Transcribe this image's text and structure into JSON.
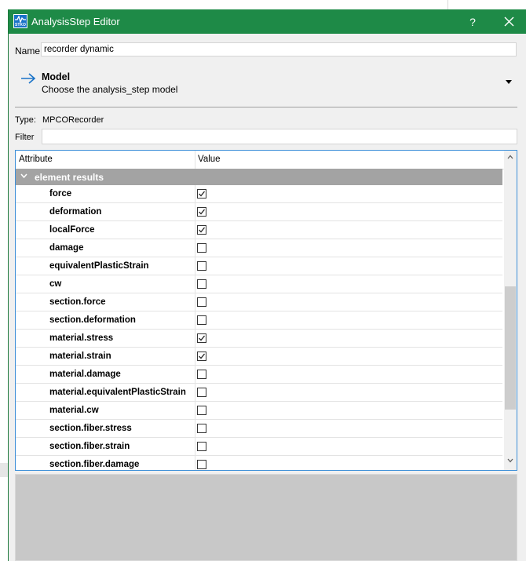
{
  "window": {
    "title": "AnalysisStep Editor",
    "help_label": "?",
    "app_icon_text": "STKO"
  },
  "name": {
    "label": "Name",
    "value": "recorder dynamic"
  },
  "model": {
    "title": "Model",
    "subtitle": "Choose the analysis_step model"
  },
  "type": {
    "label": "Type:",
    "value": "MPCORecorder"
  },
  "filter": {
    "label": "Filter",
    "value": ""
  },
  "table": {
    "headers": {
      "attribute": "Attribute",
      "value": "Value"
    },
    "group": "element results",
    "rows": [
      {
        "name": "force",
        "checked": true
      },
      {
        "name": "deformation",
        "checked": true
      },
      {
        "name": "localForce",
        "checked": true
      },
      {
        "name": "damage",
        "checked": false
      },
      {
        "name": "equivalentPlasticStrain",
        "checked": false
      },
      {
        "name": "cw",
        "checked": false
      },
      {
        "name": "section.force",
        "checked": false
      },
      {
        "name": "section.deformation",
        "checked": false
      },
      {
        "name": "material.stress",
        "checked": true
      },
      {
        "name": "material.strain",
        "checked": true
      },
      {
        "name": "material.damage",
        "checked": false
      },
      {
        "name": "material.equivalentPlasticStrain",
        "checked": false
      },
      {
        "name": "material.cw",
        "checked": false
      },
      {
        "name": "section.fiber.stress",
        "checked": false
      },
      {
        "name": "section.fiber.strain",
        "checked": false
      },
      {
        "name": "section.fiber.damage",
        "checked": false
      }
    ]
  },
  "colors": {
    "titlebar": "#1e8a47",
    "group_row": "#a3a3a3",
    "arrow": "#1a73c8",
    "selection_border": "#3c8fd8"
  }
}
